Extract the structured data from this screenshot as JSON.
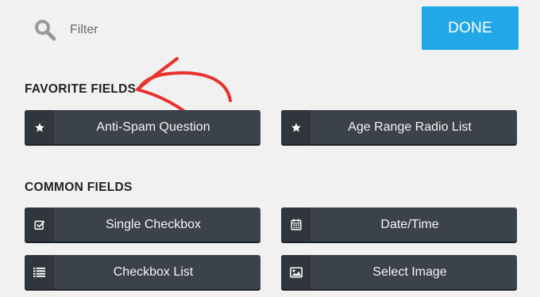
{
  "toolbar": {
    "filter_placeholder": "Filter",
    "done_label": "DONE",
    "done_color": "#22a8e6"
  },
  "favorite": {
    "title": "FAVORITE FIELDS",
    "items": [
      {
        "label": "Anti-Spam Question",
        "icon": "star-icon"
      },
      {
        "label": "Age Range Radio List",
        "icon": "star-icon"
      }
    ]
  },
  "common": {
    "title": "COMMON FIELDS",
    "items": [
      {
        "label": "Single Checkbox",
        "icon": "checkbox-icon"
      },
      {
        "label": "Date/Time",
        "icon": "calendar-icon"
      },
      {
        "label": "Checkbox List",
        "icon": "list-icon"
      },
      {
        "label": "Select Image",
        "icon": "image-icon"
      }
    ]
  },
  "annotation": {
    "arrow_color": "#e8322b"
  }
}
